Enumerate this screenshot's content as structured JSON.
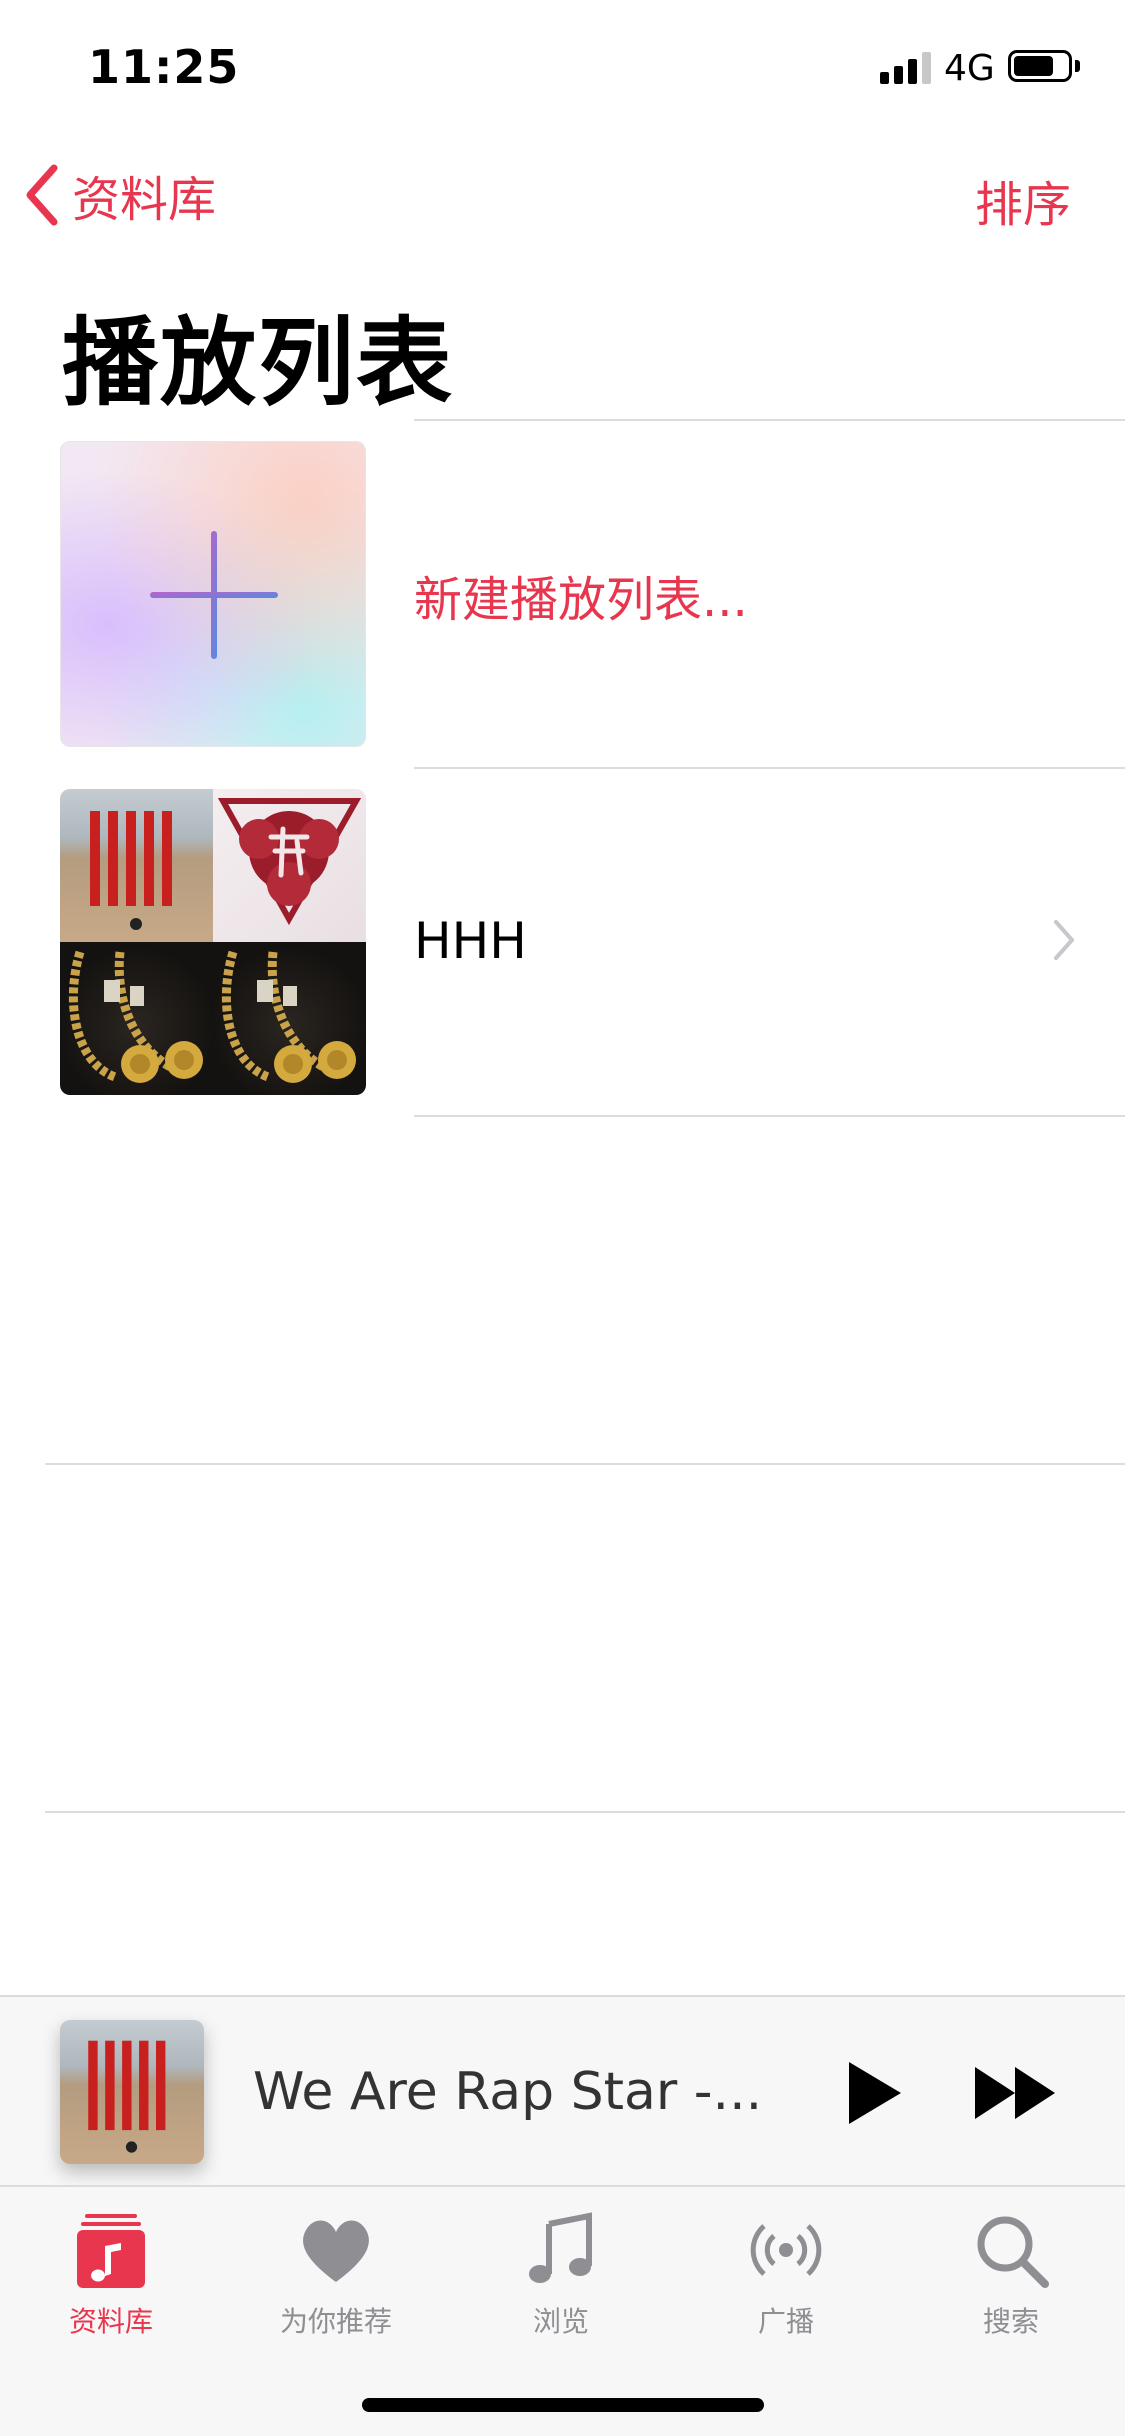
{
  "status_bar": {
    "time": "11:25",
    "network": "4G",
    "battery_level": 0.75
  },
  "nav": {
    "back_label": "资料库",
    "sort_label": "排序"
  },
  "page_title": "播放列表",
  "playlists": [
    {
      "label": "新建播放列表..."
    },
    {
      "label": "HHH"
    }
  ],
  "mini_player": {
    "title": "We Are Rap Star -..."
  },
  "tabs": [
    {
      "label": "资料库",
      "icon": "library-icon",
      "active": true
    },
    {
      "label": "为你推荐",
      "icon": "heart-icon",
      "active": false
    },
    {
      "label": "浏览",
      "icon": "music-note-icon",
      "active": false
    },
    {
      "label": "广播",
      "icon": "radio-icon",
      "active": false
    },
    {
      "label": "搜索",
      "icon": "search-icon",
      "active": false
    }
  ],
  "colors": {
    "accent": "#e8364f",
    "inactive": "#8e8e93"
  }
}
